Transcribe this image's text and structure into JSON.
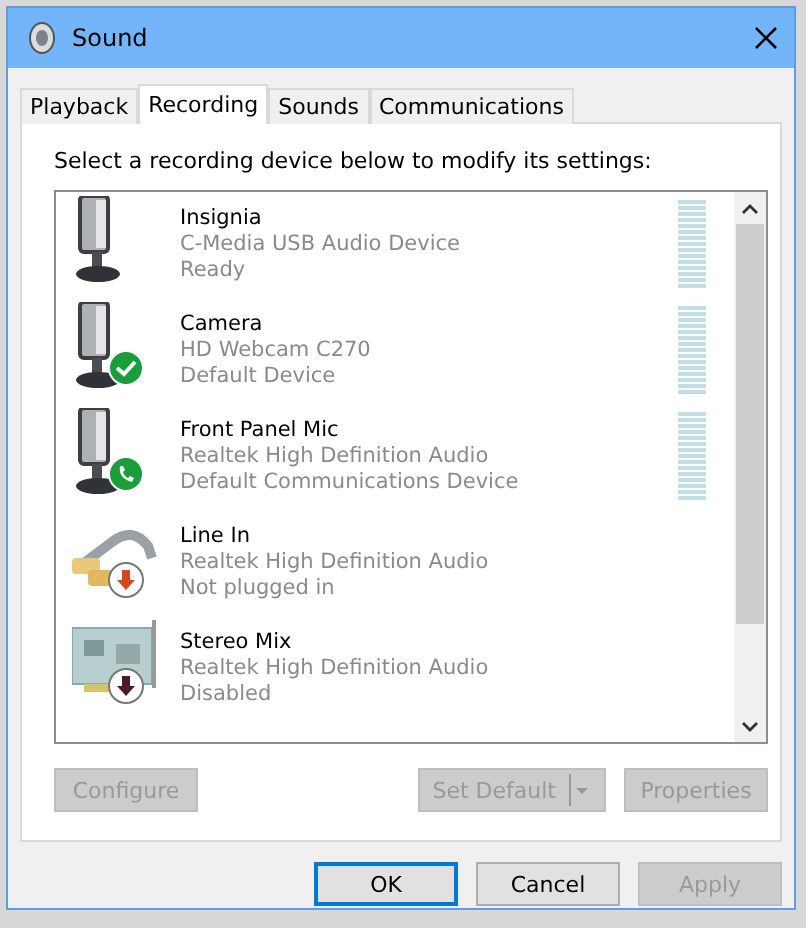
{
  "window": {
    "title": "Sound"
  },
  "tabs": [
    {
      "label": "Playback",
      "selected": false
    },
    {
      "label": "Recording",
      "selected": true
    },
    {
      "label": "Sounds",
      "selected": false
    },
    {
      "label": "Communications",
      "selected": false
    }
  ],
  "instruction": "Select a recording device below to modify its settings:",
  "devices": [
    {
      "name": "Insignia",
      "driver": "C-Media USB Audio Device",
      "status": "Ready",
      "kind": "mic",
      "meter": true
    },
    {
      "name": "Camera",
      "driver": "HD Webcam C270",
      "status": "Default Device",
      "kind": "mic",
      "badge": {
        "kind": "check"
      },
      "meter": true
    },
    {
      "name": "Front Panel Mic",
      "driver": "Realtek High Definition Audio",
      "status": "Default Communications Device",
      "kind": "mic",
      "badge": {
        "kind": "phone"
      },
      "meter": true
    },
    {
      "name": "Line In",
      "driver": "Realtek High Definition Audio",
      "status": "Not plugged in",
      "kind": "cable",
      "badge": {
        "kind": "unplugged"
      },
      "meter": false
    },
    {
      "name": "Stereo Mix",
      "driver": "Realtek High Definition Audio",
      "status": "Disabled",
      "kind": "card",
      "badge": {
        "kind": "disabled"
      },
      "meter": false
    }
  ],
  "list_buttons": [
    {
      "label": "Configure",
      "disabled": true,
      "split": false
    },
    {
      "label": "Set Default",
      "disabled": true,
      "split": true
    },
    {
      "label": "Properties",
      "disabled": true,
      "split": false
    }
  ],
  "dialog_buttons": [
    {
      "label": "OK",
      "disabled": false,
      "default": true
    },
    {
      "label": "Cancel",
      "disabled": false,
      "default": false
    },
    {
      "label": "Apply",
      "disabled": true,
      "default": false
    }
  ]
}
